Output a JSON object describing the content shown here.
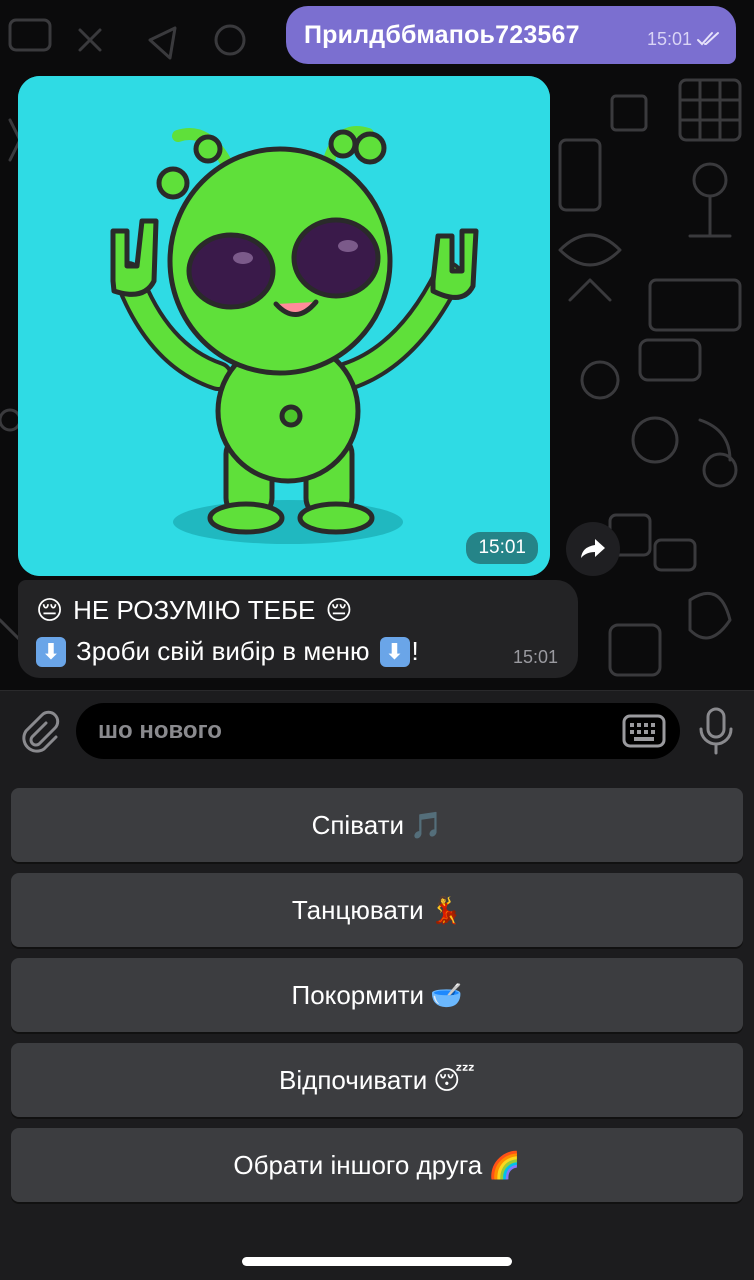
{
  "chat": {
    "outgoing": {
      "text": "Прилдббмапоь723567",
      "time": "15:01"
    },
    "image_message": {
      "time": "15:01"
    },
    "incoming": {
      "line1": "НЕ РОЗУМІЮ ТЕБЕ",
      "line2": "Зроби свій вибір в меню",
      "line2_suffix": "!",
      "time": "15:01"
    }
  },
  "input": {
    "placeholder": "шо нового"
  },
  "keyboard": {
    "buttons": [
      {
        "label": "Співати",
        "emoji": "🎵"
      },
      {
        "label": "Танцювати",
        "emoji": "💃"
      },
      {
        "label": "Покормити",
        "emoji": "🥣"
      },
      {
        "label": "Відпочивати",
        "emoji": "😴"
      },
      {
        "label": "Обрати іншого друга",
        "emoji": "🌈"
      }
    ]
  },
  "colors": {
    "outgoing_bubble": "#7b6fd0",
    "incoming_bubble": "#232325",
    "image_background": "#2fdbe4",
    "alien_green": "#5fe03a",
    "keyboard_button": "#3c3d40"
  }
}
